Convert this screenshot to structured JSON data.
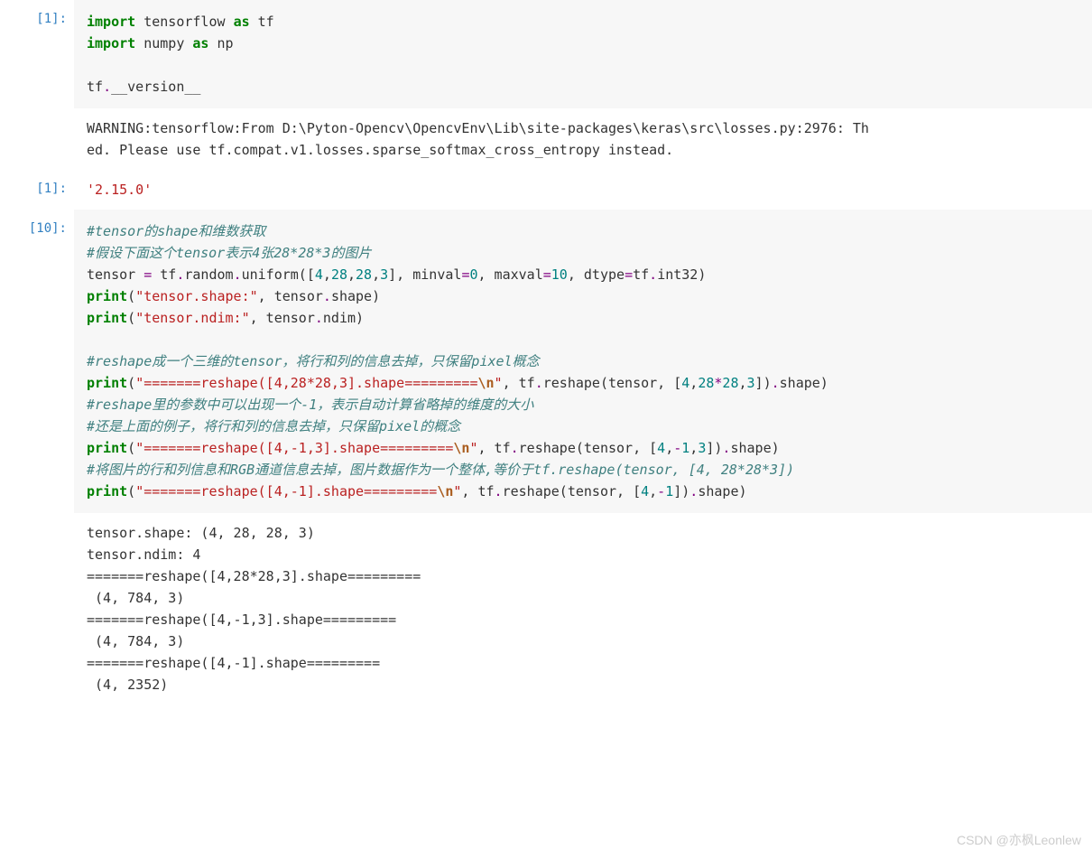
{
  "cell1": {
    "prompt": "[1]:",
    "line1_kw1": "import",
    "line1_txt1": " tensorflow ",
    "line1_kw2": "as",
    "line1_txt2": " tf",
    "line2_kw1": "import",
    "line2_txt1": " numpy ",
    "line2_kw2": "as",
    "line2_txt2": " np",
    "line4_txt1": "tf",
    "line4_dot": ".",
    "line4_txt2": "__version__"
  },
  "out1a": "WARNING:tensorflow:From D:\\Pyton-Opencv\\OpencvEnv\\Lib\\site-packages\\keras\\src\\losses.py:2976: Th\ned. Please use tf.compat.v1.losses.sparse_softmax_cross_entropy instead.",
  "out1b": {
    "prompt": "[1]:",
    "text": "'2.15.0'"
  },
  "cell2": {
    "prompt": "[10]:",
    "c1": "#tensor的shape和维数获取",
    "c2": "#假设下面这个tensor表示4张28*28*3的图片",
    "l3": {
      "a": "tensor ",
      "b": "=",
      "c": " tf",
      "d": ".",
      "e": "random",
      "f": ".",
      "g": "uniform([",
      "h": "4",
      "i": ",",
      "j": "28",
      "k": ",",
      "l": "28",
      "m": ",",
      "n": "3",
      "o": "], minval",
      "p": "=",
      "q": "0",
      "r": ", maxval",
      "s": "=",
      "t": "10",
      "u": ", dtype",
      "v": "=",
      "w": "tf",
      "x": ".",
      "y": "int32)"
    },
    "l4": {
      "a": "print",
      "b": "(",
      "c": "\"tensor.shape:\"",
      "d": ", tensor",
      "e": ".",
      "f": "shape)"
    },
    "l5": {
      "a": "print",
      "b": "(",
      "c": "\"tensor.ndim:\"",
      "d": ", tensor",
      "e": ".",
      "f": "ndim)"
    },
    "c6": "#reshape成一个三维的tensor，将行和列的信息去掉，只保留pixel概念",
    "l7": {
      "a": "print",
      "b": "(",
      "c": "\"=======reshape([4,28*28,3].shape=========",
      "d": "\\n",
      "e": "\"",
      "f": ", tf",
      "g": ".",
      "h": "reshape(tensor, [",
      "i": "4",
      "j": ",",
      "k": "28",
      "l": "*",
      "m": "28",
      "n": ",",
      "o": "3",
      "p": "])",
      "q": ".",
      "r": "shape)"
    },
    "c8": "#reshape里的参数中可以出现一个-1，表示自动计算省略掉的维度的大小",
    "c9": "#还是上面的例子，将行和列的信息去掉，只保留pixel的概念",
    "l10": {
      "a": "print",
      "b": "(",
      "c": "\"=======reshape([4,-1,3].shape=========",
      "d": "\\n",
      "e": "\"",
      "f": ", tf",
      "g": ".",
      "h": "reshape(tensor, [",
      "i": "4",
      "j": ",",
      "k": "-",
      "l": "1",
      "m": ",",
      "n": "3",
      "o": "])",
      "p": ".",
      "q": "shape)"
    },
    "c11": "#将图片的行和列信息和RGB通道信息去掉，图片数据作为一个整体,等价于tf.reshape(tensor, [4, 28*28*3])",
    "l12": {
      "a": "print",
      "b": "(",
      "c": "\"=======reshape([4,-1].shape=========",
      "d": "\\n",
      "e": "\"",
      "f": ", tf",
      "g": ".",
      "h": "reshape(tensor, [",
      "i": "4",
      "j": ",",
      "k": "-",
      "l": "1",
      "m": "])",
      "n": ".",
      "o": "shape)"
    }
  },
  "out2": "tensor.shape: (4, 28, 28, 3)\ntensor.ndim: 4\n=======reshape([4,28*28,3].shape=========\n (4, 784, 3)\n=======reshape([4,-1,3].shape=========\n (4, 784, 3)\n=======reshape([4,-1].shape=========\n (4, 2352)",
  "watermark": "CSDN @亦枫Leonlew"
}
